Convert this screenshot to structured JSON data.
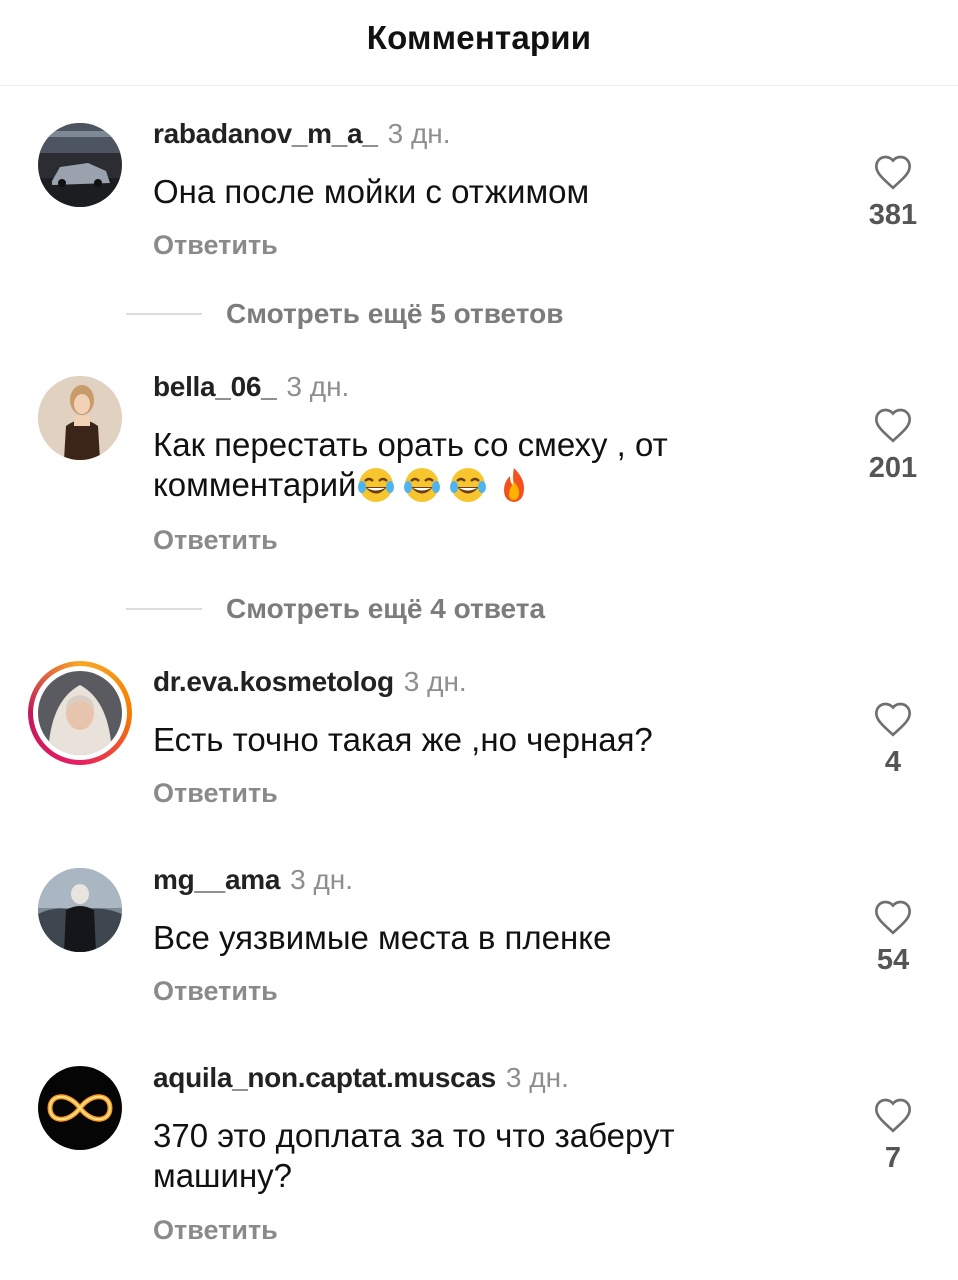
{
  "header": {
    "title": "Комментарии"
  },
  "comments": [
    {
      "username": "rabadanov_m_a_",
      "time": "3 дн.",
      "text": "Она после мойки с отжимом",
      "reply": "Ответить",
      "likes": "381",
      "more_replies": "Смотреть ещё 5 ответов"
    },
    {
      "username": "bella_06_",
      "time": "3 дн.",
      "text_line1": "Как перестать орать со смеху , от",
      "text_line2": "комментарий",
      "emojis": [
        "face-with-tears-of-joy",
        "face-with-tears-of-joy",
        "face-with-tears-of-joy",
        "fire"
      ],
      "reply": "Ответить",
      "likes": "201",
      "more_replies": "Смотреть ещё 4 ответа"
    },
    {
      "username": "dr.eva.kosmetolog",
      "time": "3 дн.",
      "text": "Есть точно такая же ,но черная?",
      "reply": "Ответить",
      "likes": "4"
    },
    {
      "username": "mg__ama",
      "time": "3 дн.",
      "text": "Все уязвимые места в пленке",
      "reply": "Ответить",
      "likes": "54"
    },
    {
      "username": "aquila_non.captat.muscas",
      "time": "3 дн.",
      "text_line1": "370 это доплата за то что заберут",
      "text_line2": "машину?",
      "reply": "Ответить",
      "likes": "7"
    }
  ],
  "icons": {
    "like": "heart-outline-icon"
  },
  "colors": {
    "story_ring": "#f57c00",
    "muted": "#8e8e8e"
  }
}
